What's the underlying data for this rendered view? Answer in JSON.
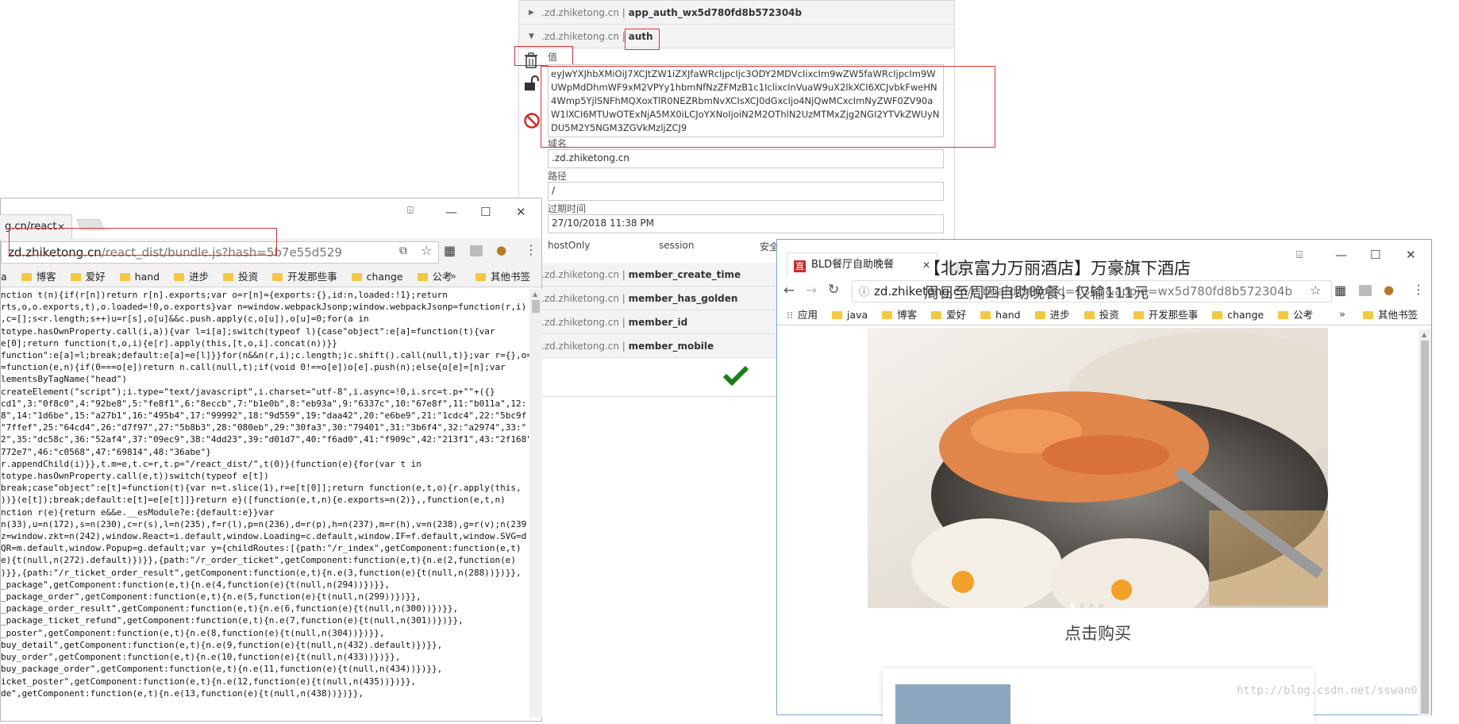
{
  "cookie_panel": {
    "rows_top": [
      {
        "domain": ".zd.zhiketong.cn",
        "name": "app_auth_wx5d780fd8b572304b",
        "expanded": false
      },
      {
        "domain": ".zd.zhiketong.cn",
        "name": "auth",
        "expanded": true
      }
    ],
    "value_label": "值",
    "value": "eyJwYXJhbXMiOiJ7XCJtZW1iZXJfaWRcIjpcIjc3ODY2MDVcIixcIm9wZW5faWRcIjpcIm9WUWpMdDhmWF9xM2VPYy1hbmNfNzZFMzB1c1IclixcInVuaW9uX2lkXCI6XCJvbkFweHN4Wmp5YjlSNFhMQXoxTlR0NEZRbmNvXCIsXCJ0dGxcIjo4NjQwMCxcImNyZWF0ZV90aW1lXCI6MTUwOTExNjA5MX0iLCJoYXNoIjoiN2M2OThlN2UzMTMxZjg2NGI2YTVkZWUyNDU5M2Y5NGM3ZGVkMzljZCJ9",
    "domain_label": "域名",
    "domain_value": ".zd.zhiketong.cn",
    "path_label": "路径",
    "path_value": "/",
    "expires_label": "过期时间",
    "expires_value": "27/10/2018 11:38 PM",
    "flags": [
      "hostOnly",
      "session",
      "安全"
    ],
    "rows_bottom": [
      {
        "domain": ".zd.zhiketong.cn",
        "name": "member_create_time"
      },
      {
        "domain": ".zd.zhiketong.cn",
        "name": "member_has_golden"
      },
      {
        "domain": ".zd.zhiketong.cn",
        "name": "member_id"
      },
      {
        "domain": ".zd.zhiketong.cn",
        "name": "member_mobile"
      }
    ]
  },
  "left_window": {
    "tab_title": "g.cn/react",
    "url_main": "zd.zhiketong.cn",
    "url_rest": "/react_dist/bundle.js?hash=5b7e55d529",
    "bookmarks": [
      "a",
      "博客",
      "爱好",
      "hand",
      "进步",
      "投资",
      "开发那些事",
      "change",
      "公考"
    ],
    "bookmarks_more": "»",
    "other_bookmarks": "其他书签",
    "code_lines": [
      "nction t(n){if(r[n])return r[n].exports;var o=r[n]={exports:{},id:n,loaded:!1};return",
      "rts,o,o.exports,t),o.loaded=!0,o.exports}var n=window.webpackJsonp;window.webpackJsonp=function(r,i)",
      ",c=[];s<r.length;s++)u=r[s],o[u]&&c.push.apply(c,o[u]),o[u]=0;for(a in",
      "totype.hasOwnProperty.call(i,a)){var l=i[a];switch(typeof l){case\"object\":e[a]=function(t){var",
      "e[0];return function(t,o,i){e[r].apply(this,[t,o,i].concat(n))}}",
      "function\":e[a]=l;break;default:e[a]=e[l]}}for(n&&n(r,i);c.length;)c.shift().call(null,t)};var r={},o=",
      "=function(e,n){if(0===o[e])return n.call(null,t);if(void 0!==o[e])o[e].push(n);else{o[e]=[n];var",
      "lementsByTagName(\"head\")",
      "createElement(\"script\");i.type=\"text/javascript\",i.charset=\"utf-8\",i.async=!0,i.src=t.p+\"\"+({}",
      "",
      "cd1\",3:\"0f8c0\",4:\"92be8\",5:\"fe8f1\",6:\"8eccb\",7:\"b1e0b\",8:\"eb93a\",9:\"6337c\",10:\"67e8f\",11:\"b011a\",12:",
      "8\",14:\"1d6be\",15:\"a27b1\",16:\"495b4\",17:\"99992\",18:\"9d559\",19:\"daa42\",20:\"e6be9\",21:\"1cdc4\",22:\"5bc9f",
      "\"7ffef\",25:\"64cd4\",26:\"d7f97\",27:\"5b8b3\",28:\"080eb\",29:\"30fa3\",30:\"79401\",31:\"3b6f4\",32:\"a2974\",33:\"",
      "2\",35:\"dc58c\",36:\"52af4\",37:\"09ec9\",38:\"4dd23\",39:\"d01d7\",40:\"f6ad0\",41:\"f909c\",42:\"213f1\",43:\"2f168\"",
      "772e7\",46:\"c0568\",47:\"69814\",48:\"36abe\"}",
      "r.appendChild(i)}},t.m=e,t.c=r,t.p=\"/react_dist/\",t(0)}(function(e){for(var t in",
      "totype.hasOwnProperty.call(e,t))switch(typeof e[t])",
      "break;case\"object\":e[t]=function(t){var n=t.slice(1),r=e[t[0]];return function(e,t,o){r.apply(this,",
      "))}(e[t]);break;default:e[t]=e[e[t]]}return e}([function(e,t,n){e.exports=n(2)},,function(e,t,n)",
      "nction r(e){return e&&e.__esModule?e:{default:e}}var",
      "n(33),u=n(172),s=n(230),c=r(s),l=n(235),f=r(l),p=n(236),d=r(p),h=n(237),m=r(h),v=n(238),g=r(v);n(239",
      "z=window.zkt=n(242),window.React=i.default,window.Loading=c.default,window.IF=f.default,window.SVG=d",
      "QR=m.default,window.Popup=g.default;var y={childRoutes:[{path:\"/r_index\",getComponent:function(e,t)",
      "e){t(null,n(272).default)})}},{path:\"/r_order_ticket\",getComponent:function(e,t){n.e(2,function(e)",
      ")}},{path:\"/r_ticket_order_result\",getComponent:function(e,t){n.e(3,function(e){t(null,n(288))})}},",
      "_package\",getComponent:function(e,t){n.e(4,function(e){t(null,n(294))})}},",
      "_package_order\",getComponent:function(e,t){n.e(5,function(e){t(null,n(299))})}},",
      "_package_order_result\",getComponent:function(e,t){n.e(6,function(e){t(null,n(300))})}},",
      "_package_ticket_refund\",getComponent:function(e,t){n.e(7,function(e){t(null,n(301))})}},",
      "_poster\",getComponent:function(e,t){n.e(8,function(e){t(null,n(304))})}},",
      "buy_detail\",getComponent:function(e,t){n.e(9,function(e){t(null,n(432).default)})}},",
      "buy_order\",getComponent:function(e,t){n.e(10,function(e){t(null,n(433))})}},",
      "buy_package_order\",getComponent:function(e,t){n.e(11,function(e){t(null,n(434))})}},",
      "icket_poster\",getComponent:function(e,t){n.e(12,function(e){t(null,n(435))})}},",
      "de\",getComponent:function(e,t){n.e(13,function(e){t(null,n(438))})}},"
    ]
  },
  "right_window": {
    "tab_title": "BLD餐厅自助晚餐",
    "url_main": "zd.zhiketong.cn",
    "url_rest": "/r_board/5tab?id=1365&appid=wx5d780fd8b572304b",
    "apps_label": "应用",
    "bookmarks": [
      "java",
      "博客",
      "爱好",
      "hand",
      "进步",
      "投资",
      "开发那些事",
      "change",
      "公考"
    ],
    "bookmarks_more": "»",
    "other_bookmarks": "其他书签",
    "buy_label": "点击购买",
    "card_title": "【北京富力万丽酒店】万豪旗下酒店",
    "card_subtitle": "周日至周四自助晚餐，仅输111元"
  },
  "watermark": "http://blog.csdn.net/sswan0",
  "colors": {
    "accent_red": "#d33333",
    "check_green": "#1a7f1a",
    "folder_yellow": "#f5c842",
    "window_border": "#7aa6da"
  }
}
